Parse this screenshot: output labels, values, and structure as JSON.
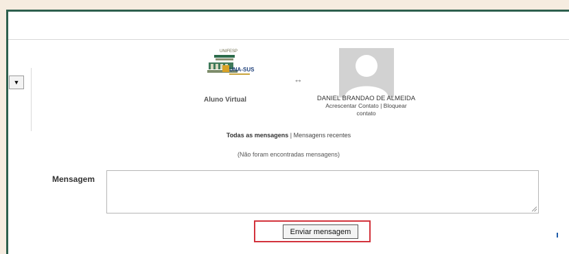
{
  "left_select": {
    "arrow": "▼"
  },
  "logo": {
    "top_text": "UNIFESP",
    "brand_text": "UNA-SUS"
  },
  "arrow_symbol": "↔",
  "left_user": {
    "name": "Aluno Virtual"
  },
  "right_user": {
    "name": "DANIEL BRANDAO DE ALMEIDA",
    "actions_line1": "Acrescentar Contato | Bloquear",
    "actions_line2": "contato"
  },
  "messages": {
    "all_label": "Todas as mensagens",
    "separator": " | ",
    "recent_label": "Mensagens recentes",
    "empty_text": "(Não foram encontradas mensagens)"
  },
  "compose": {
    "label": "Mensagem",
    "value": "",
    "send_label": "Enviar mensagem"
  },
  "colors": {
    "frame_border": "#2d5f4d",
    "highlight": "#d2313a",
    "background": "#f6ece0"
  }
}
